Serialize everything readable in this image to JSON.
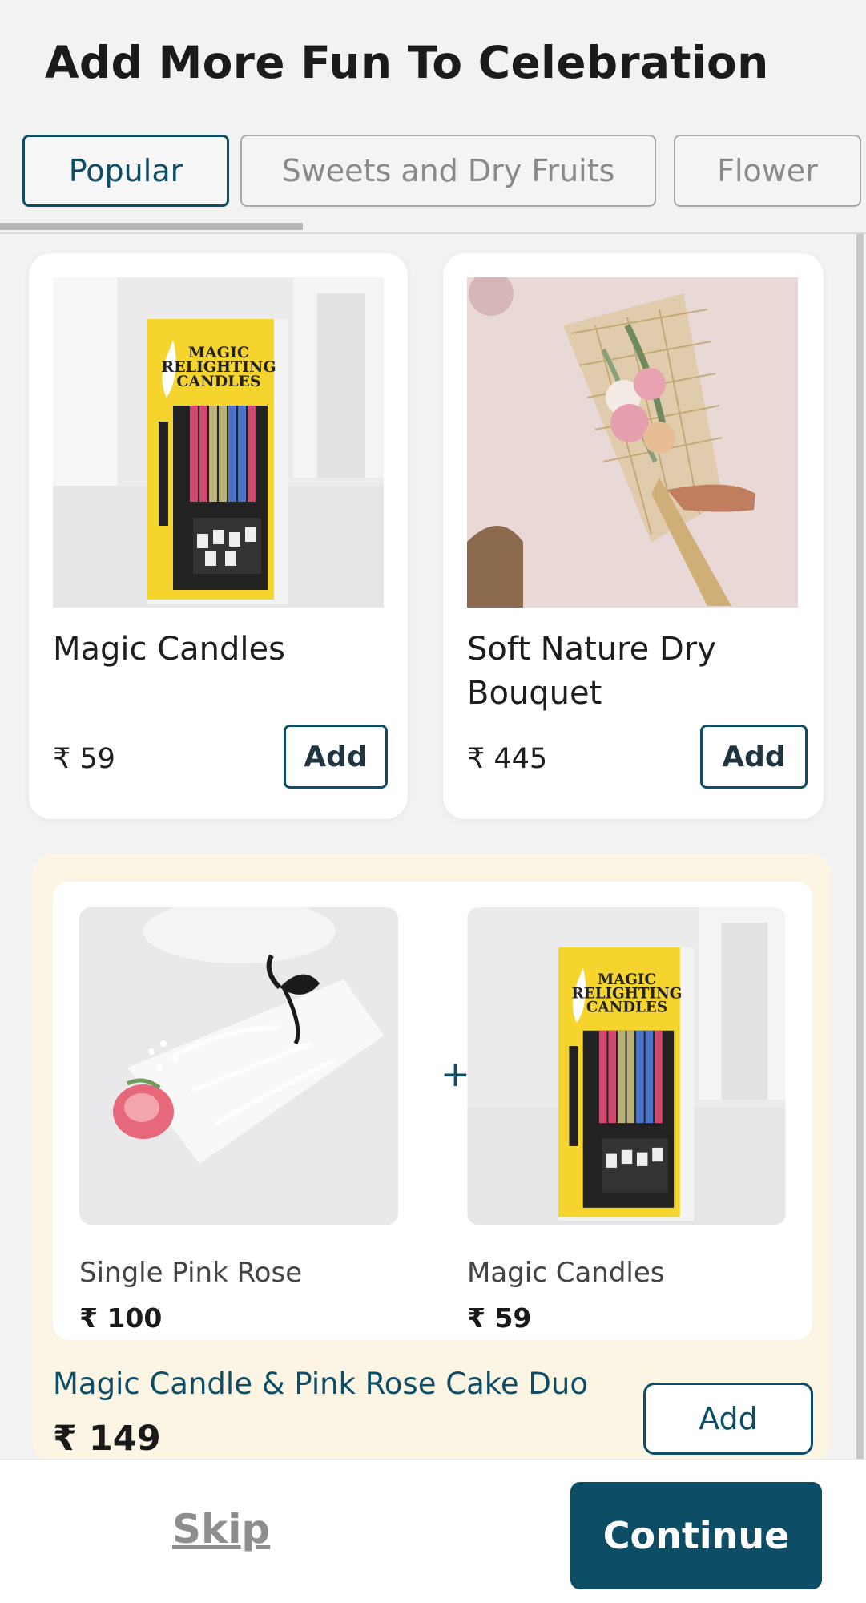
{
  "header": {
    "title": "Add More Fun To Celebration"
  },
  "tabs": [
    {
      "label": "Popular",
      "active": true
    },
    {
      "label": "Sweets and Dry Fruits",
      "active": false
    },
    {
      "label": "Flower",
      "active": false
    }
  ],
  "products": [
    {
      "name": "Magic Candles",
      "price": "₹ 59",
      "add_label": "Add",
      "image": "magic-relighting-candles-pack"
    },
    {
      "name": "Soft Nature Dry Bouquet",
      "price": "₹ 445",
      "add_label": "Add",
      "image": "dry-flower-bouquet"
    }
  ],
  "combo": {
    "items": [
      {
        "name": "Single Pink Rose",
        "price": "₹ 100",
        "image": "single-pink-rose"
      },
      {
        "name": "Magic Candles",
        "price": "₹ 59",
        "image": "magic-relighting-candles-pack"
      }
    ],
    "plus_symbol": "+",
    "title": "Magic Candle & Pink Rose Cake Duo",
    "price": "₹ 149",
    "add_label": "Add"
  },
  "candle_pack": {
    "line1": "MAGIC",
    "line2": "RELIGHTING",
    "line3": "CANDLES"
  },
  "footer": {
    "skip_label": "Skip",
    "continue_label": "Continue"
  },
  "colors": {
    "primary": "#0e4d66",
    "combo_bg": "#fdf5e4",
    "page_bg": "#f2f2f2"
  }
}
